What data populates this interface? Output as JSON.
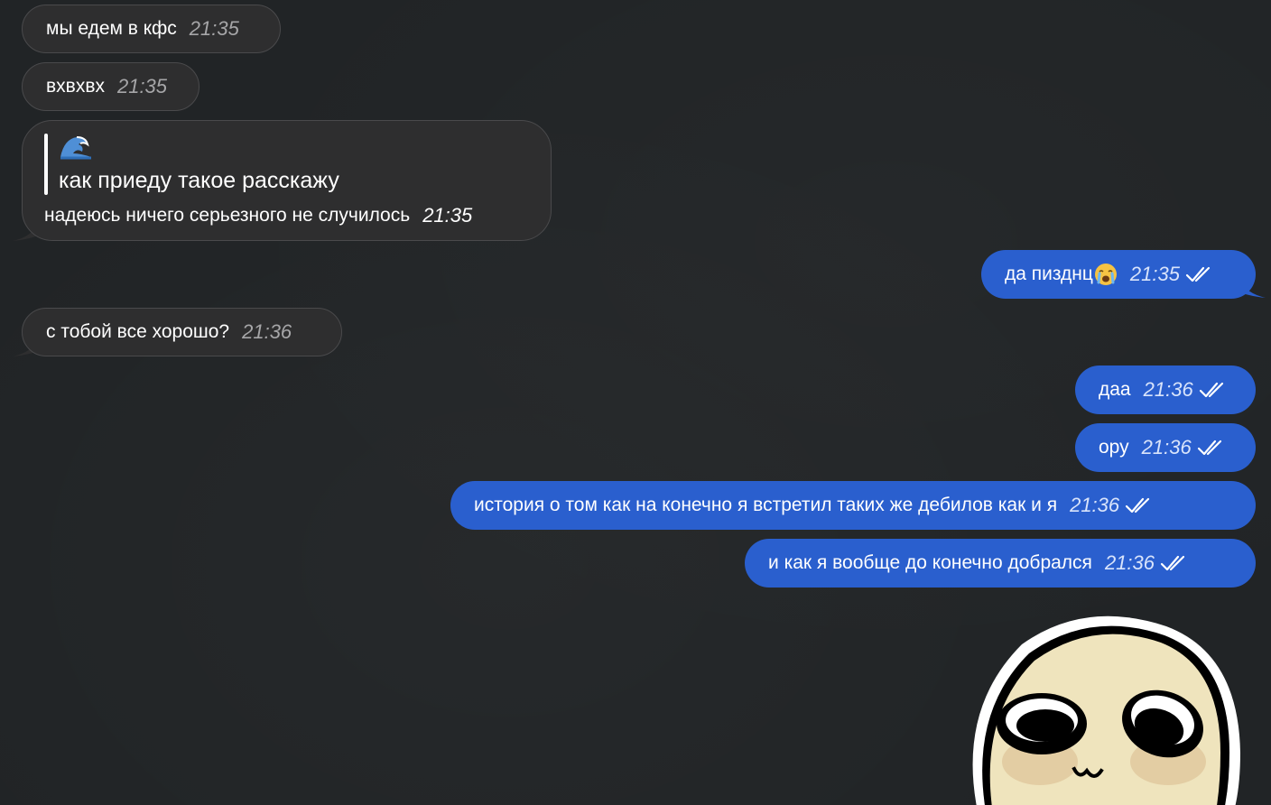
{
  "messages": [
    {
      "text": "мы едем в кфс",
      "time": "21:35"
    },
    {
      "text": "вхвхвх",
      "time": "21:35"
    },
    {
      "quote_emoji": "wave-emoji",
      "quote_text": "как приеду такое расскажу",
      "text": "надеюсь ничего серьезного не случилось",
      "time": "21:35"
    },
    {
      "text": "да пизднц",
      "emoji": "crying-face-emoji",
      "time": "21:35"
    },
    {
      "text": "с тобой все хорошо?",
      "time": "21:36"
    },
    {
      "text": "даа",
      "time": "21:36"
    },
    {
      "text": "ору",
      "time": "21:36"
    },
    {
      "text": "история о том как на конечно я встретил таких же дебилов как и я",
      "time": "21:36"
    },
    {
      "text": "и как я вообще до конечно добрался",
      "time": "21:36"
    }
  ],
  "sticker": {
    "icon": "cartoon-face-sticker"
  },
  "colors": {
    "background": "#212426",
    "incoming_bubble": "#2e2e2f",
    "outgoing_bubble": "#2a5fce"
  }
}
